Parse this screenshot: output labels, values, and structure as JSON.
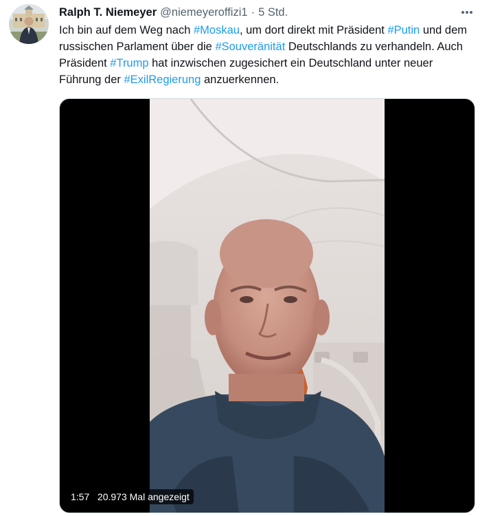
{
  "author": {
    "name": "Ralph T. Niemeyer",
    "handle": "@niemeyeroffizi1",
    "separator": "·",
    "time": "5 Std."
  },
  "tweet": {
    "segments": [
      {
        "text": "Ich bin auf dem Weg nach ",
        "type": "text"
      },
      {
        "text": "#Moskau",
        "type": "hashtag"
      },
      {
        "text": ", um dort direkt mit Präsident ",
        "type": "text"
      },
      {
        "text": "#Putin",
        "type": "hashtag"
      },
      {
        "text": " und dem russischen Parlament über die ",
        "type": "text"
      },
      {
        "text": "#Souveränität",
        "type": "hashtag"
      },
      {
        "text": " Deutschlands zu verhandeln. Auch Präsident ",
        "type": "text"
      },
      {
        "text": "#Trump",
        "type": "hashtag"
      },
      {
        "text": " hat inzwischen zugesichert ein Deutschland unter neuer Führung der ",
        "type": "text"
      },
      {
        "text": "#ExilRegierung",
        "type": "hashtag"
      },
      {
        "text": " anzuerkennen.",
        "type": "text"
      }
    ]
  },
  "video": {
    "duration": "1:57",
    "views": "20.973 Mal angezeigt"
  },
  "icons": {
    "more": "more-horizontal-icon"
  },
  "colors": {
    "link": "#1d9bf0",
    "text": "#0f1419",
    "muted": "#536471"
  }
}
